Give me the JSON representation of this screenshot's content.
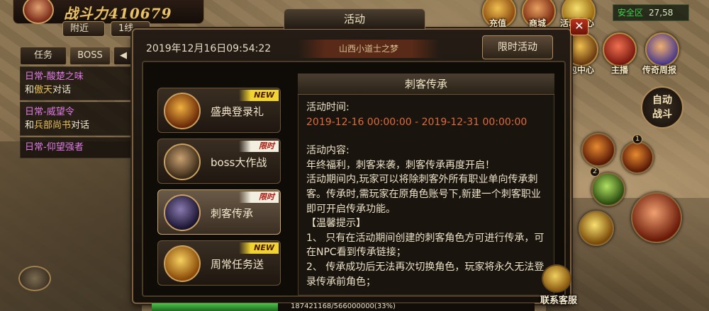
{
  "player": {
    "power_text": "战斗力410679",
    "nearby_label": "附近",
    "line_label": "1线"
  },
  "zone": {
    "label": "安全区",
    "coords": "27,58"
  },
  "top_icons": [
    {
      "name": "recharge",
      "label": "充值"
    },
    {
      "name": "shop",
      "label": "商城"
    },
    {
      "name": "event-center",
      "label": "活动中心"
    },
    {
      "name": "gift-center",
      "label": "礼包中心"
    },
    {
      "name": "anchor",
      "label": "主播"
    },
    {
      "name": "legend-report",
      "label": "传奇周报"
    }
  ],
  "task_panel": {
    "tab_tasks": "任务",
    "tab_boss": "BOSS",
    "collapse_icon": "left-arrow",
    "items": [
      {
        "title": "日常-酸楚之味",
        "desc_pre": "和",
        "desc_hl": "傲天",
        "desc_post": "对话"
      },
      {
        "title": "日常-威望令",
        "desc_pre": "和",
        "desc_hl": "兵部尚书",
        "desc_post": "对话"
      },
      {
        "title": "日常-仰望强者",
        "desc_pre": "",
        "desc_hl": "",
        "desc_post": ""
      }
    ]
  },
  "window": {
    "title": "活动",
    "datetime": "2019年12月16日09:54:22",
    "banner_text": "山西小道士之梦",
    "limited_tab": "限时活动",
    "close_icon": "close-icon"
  },
  "activities": [
    {
      "label": "盛典登录礼",
      "tag": "NEW",
      "tag_type": "new",
      "selected": false
    },
    {
      "label": "boss大作战",
      "tag": "限时",
      "tag_type": "limit",
      "selected": false
    },
    {
      "label": "刺客传承",
      "tag": "限时",
      "tag_type": "limit",
      "selected": true
    },
    {
      "label": "周常任务送",
      "tag": "NEW",
      "tag_type": "new",
      "selected": false
    }
  ],
  "detail": {
    "title": "刺客传承",
    "time_label": "活动时间:",
    "time_value": "2019-12-16 00:00:00 - 2019-12-31 00:00:00",
    "content_label": "活动内容:",
    "content_lines": [
      "年终福利，刺客来袭，刺客传承再度开启！",
      "活动期间内,玩家可以将除刺客外所有职业单向传承刺客。传承时,需玩家在原角色账号下,新建一个刺客职业即可开启传承功能。",
      "【温馨提示】",
      "1、 只有在活动期间创建的刺客角色方可进行传承，可在NPC看到传承链接；",
      "2、 传承成功后无法再次切换角色，玩家将永久无法登录传承前角色；"
    ]
  },
  "right_panel": {
    "auto_fight": "自动战斗",
    "badge_1": "1",
    "badge_2": "2",
    "customer_service": "联系客服"
  },
  "exp_bar": {
    "text": "187421168/566000000(33%)",
    "percent": 33
  },
  "colors": {
    "task_title": "#e07ae6",
    "highlight": "#e8c15a",
    "safe_zone": "#3fd24a",
    "date_red": "#e06a3a"
  }
}
